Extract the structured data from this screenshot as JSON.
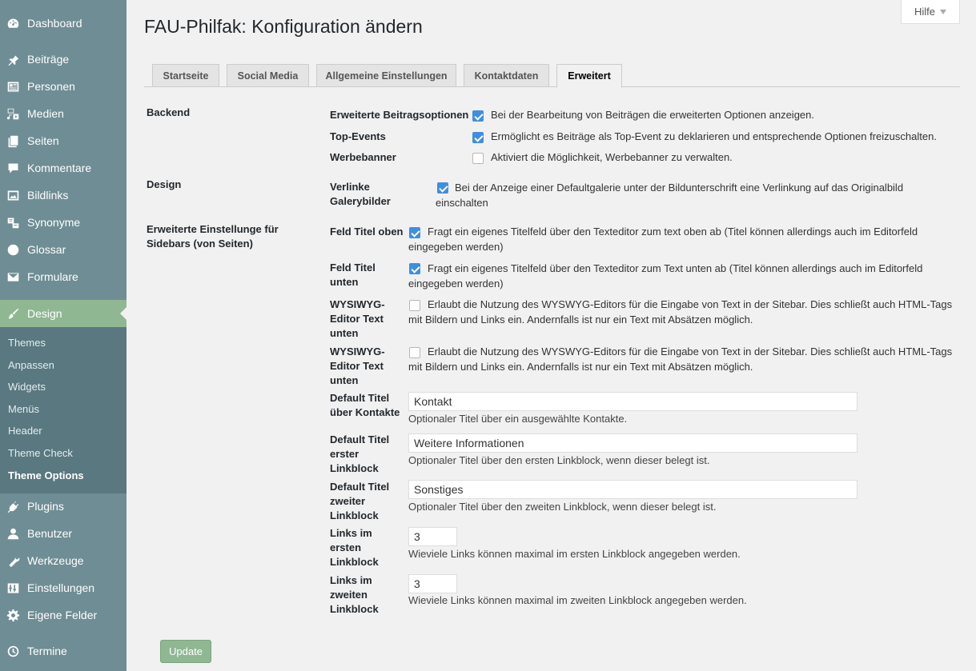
{
  "sidebar": {
    "items": [
      {
        "label": "Dashboard",
        "icon": "dashboard-icon"
      },
      {
        "label": "Beiträge",
        "icon": "pin-icon"
      },
      {
        "label": "Personen",
        "icon": "id-card-icon"
      },
      {
        "label": "Medien",
        "icon": "media-icon"
      },
      {
        "label": "Seiten",
        "icon": "pages-icon"
      },
      {
        "label": "Kommentare",
        "icon": "comment-icon"
      },
      {
        "label": "Bildlinks",
        "icon": "image-icon"
      },
      {
        "label": "Synonyme",
        "icon": "translation-icon"
      },
      {
        "label": "Glossar",
        "icon": "help-icon"
      },
      {
        "label": "Formulare",
        "icon": "mail-icon"
      },
      {
        "label": "Design",
        "icon": "brush-icon"
      },
      {
        "label": "Plugins",
        "icon": "plugin-icon"
      },
      {
        "label": "Benutzer",
        "icon": "user-icon"
      },
      {
        "label": "Werkzeuge",
        "icon": "wrench-icon"
      },
      {
        "label": "Einstellungen",
        "icon": "settings-icon"
      },
      {
        "label": "Eigene Felder",
        "icon": "gear-icon"
      },
      {
        "label": "Termine",
        "icon": "clock-icon"
      }
    ],
    "submenu": [
      "Themes",
      "Anpassen",
      "Widgets",
      "Menüs",
      "Header",
      "Theme Check",
      "Theme Options"
    ],
    "active_color": "#8fb792"
  },
  "help_tab": {
    "label": "Hilfe"
  },
  "page_title": "FAU-Philfak: Konfiguration ändern",
  "tabs": [
    "Startseite",
    "Social Media",
    "Allgemeine Einstellungen",
    "Kontaktdaten",
    "Erweitert"
  ],
  "active_tab": "Erweitert",
  "sections": {
    "backend": "Backend",
    "design": "Design",
    "sidebars_line1": "Erweiterte Einstellunge für",
    "sidebars_line2": "Sidebars (von Seiten)"
  },
  "fields": {
    "beitragsoptionen": {
      "label": "Erweiterte Beitragsoptionen",
      "checked": true,
      "desc": "Bei der Bearbeitung von Beiträgen die erweiterten Optionen anzeigen."
    },
    "topevents": {
      "label": "Top-Events",
      "checked": true,
      "desc": "Ermöglicht es Beiträge als Top-Event zu deklarieren und entsprechende Optionen freizuschalten."
    },
    "werbebanner": {
      "label": "Werbebanner",
      "checked": false,
      "desc": "Aktiviert die Möglichkeit, Werbebanner zu verwalten."
    },
    "galerie": {
      "label1": "Verlinke",
      "label2": "Galerybilder",
      "checked": true,
      "desc1": "Bei der Anzeige einer Defaultgalerie unter der Bildunterschrift eine Verlinkung auf das Originalbild",
      "desc2": "einschalten"
    },
    "titel_oben": {
      "label": "Feld Titel oben",
      "checked": true,
      "desc1": "Fragt ein eigenes Titelfeld über den Texteditor zum text oben ab (Titel können allerdings auch im Editorfeld",
      "desc2": "eingegeben werden)"
    },
    "titel_unten": {
      "label1": "Feld Titel",
      "label2": "unten",
      "checked": true,
      "desc1": "Fragt ein eigenes Titelfeld über den Texteditor zum Text unten ab (Titel können allerdings auch im Editorfeld",
      "desc2": "eingegeben werden)"
    },
    "wysiwyg1": {
      "label1": "WYSIWYG-",
      "label2": "Editor Text",
      "label3": "unten",
      "checked": false,
      "desc1": "Erlaubt die Nutzung des WYSWYG-Editors für die Eingabe von Text in der Sitebar. Dies schließt auch HTML-Tags",
      "desc2": "mit Bildern und Links ein. Andernfalls ist nur ein Text mit Absätzen möglich."
    },
    "wysiwyg2": {
      "label1": "WYSIWYG-",
      "label2": "Editor Text",
      "label3": "unten",
      "checked": false,
      "desc1": "Erlaubt die Nutzung des WYSWYG-Editors für die Eingabe von Text in der Sitebar. Dies schließt auch HTML-Tags",
      "desc2": "mit Bildern und Links ein. Andernfalls ist nur ein Text mit Absätzen möglich."
    },
    "titel_kontakte": {
      "label1": "Default Titel",
      "label2": "über Kontakte",
      "value": "Kontakt",
      "help": "Optionaler Titel über ein ausgewählte Kontakte."
    },
    "titel_linkblock1": {
      "label1": "Default Titel",
      "label2": "erster",
      "label3": "Linkblock",
      "value": "Weitere Informationen",
      "help": "Optionaler Titel über den ersten Linkblock, wenn dieser belegt ist."
    },
    "titel_linkblock2": {
      "label1": "Default Titel",
      "label2": "zweiter",
      "label3": "Linkblock",
      "value": "Sonstiges",
      "help": "Optionaler Titel über den zweiten Linkblock, wenn dieser belegt ist."
    },
    "links_linkblock1": {
      "label1": "Links im",
      "label2": "ersten",
      "label3": "Linkblock",
      "value": "3",
      "help": "Wieviele Links können maximal im ersten Linkblock angegeben werden."
    },
    "links_linkblock2": {
      "label1": "Links im",
      "label2": "zweiten",
      "label3": "Linkblock",
      "value": "3",
      "help": "Wieviele Links können maximal im zweiten Linkblock angegeben werden."
    }
  },
  "update_button": "Update"
}
